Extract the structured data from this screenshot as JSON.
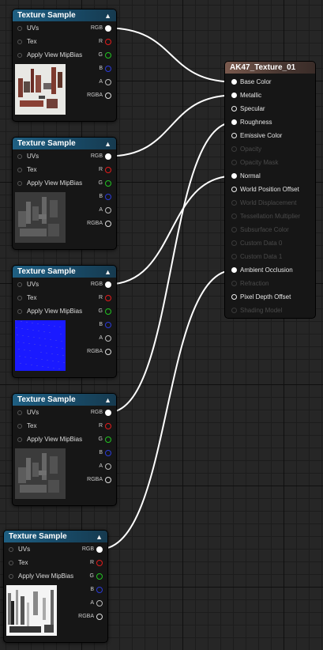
{
  "texture_nodes": [
    {
      "title": "Texture Sample",
      "inputs": [
        "UVs",
        "Tex",
        "Apply View MipBias"
      ],
      "outputs": [
        {
          "label": "RGB",
          "color": "#ffffff"
        },
        {
          "label": "R",
          "color": "#e21c1c"
        },
        {
          "label": "G",
          "color": "#22c422"
        },
        {
          "label": "B",
          "color": "#2a3bd8"
        },
        {
          "label": "A",
          "color": "#bbbbbb"
        },
        {
          "label": "RGBA",
          "color": "#dddddd"
        }
      ],
      "preview": "metal-parts-color"
    },
    {
      "title": "Texture Sample",
      "inputs": [
        "UVs",
        "Tex",
        "Apply View MipBias"
      ],
      "outputs": [
        {
          "label": "RGB",
          "color": "#ffffff"
        },
        {
          "label": "R",
          "color": "#e21c1c"
        },
        {
          "label": "G",
          "color": "#22c422"
        },
        {
          "label": "B",
          "color": "#2a3bd8"
        },
        {
          "label": "A",
          "color": "#bbbbbb"
        },
        {
          "label": "RGBA",
          "color": "#dddddd"
        }
      ],
      "preview": "metallic-gray"
    },
    {
      "title": "Texture Sample",
      "inputs": [
        "UVs",
        "Tex",
        "Apply View MipBias"
      ],
      "outputs": [
        {
          "label": "RGB",
          "color": "#ffffff"
        },
        {
          "label": "R",
          "color": "#e21c1c"
        },
        {
          "label": "G",
          "color": "#22c422"
        },
        {
          "label": "B",
          "color": "#2a3bd8"
        },
        {
          "label": "A",
          "color": "#bbbbbb"
        },
        {
          "label": "RGBA",
          "color": "#dddddd"
        }
      ],
      "preview": "normal-blue"
    },
    {
      "title": "Texture Sample",
      "inputs": [
        "UVs",
        "Tex",
        "Apply View MipBias"
      ],
      "outputs": [
        {
          "label": "RGB",
          "color": "#ffffff"
        },
        {
          "label": "R",
          "color": "#e21c1c"
        },
        {
          "label": "G",
          "color": "#22c422"
        },
        {
          "label": "B",
          "color": "#2a3bd8"
        },
        {
          "label": "A",
          "color": "#bbbbbb"
        },
        {
          "label": "RGBA",
          "color": "#dddddd"
        }
      ],
      "preview": "roughness-gray"
    },
    {
      "title": "Texture Sample",
      "inputs": [
        "UVs",
        "Tex",
        "Apply View MipBias"
      ],
      "outputs": [
        {
          "label": "RGB",
          "color": "#ffffff"
        },
        {
          "label": "R",
          "color": "#e21c1c"
        },
        {
          "label": "G",
          "color": "#22c422"
        },
        {
          "label": "B",
          "color": "#2a3bd8"
        },
        {
          "label": "A",
          "color": "#bbbbbb"
        },
        {
          "label": "RGBA",
          "color": "#dddddd"
        }
      ],
      "preview": "ao-white"
    }
  ],
  "material_node": {
    "title": "AK47_Texture_01",
    "pins": [
      {
        "label": "Base Color",
        "active": true,
        "connected": true
      },
      {
        "label": "Metallic",
        "active": true,
        "connected": true
      },
      {
        "label": "Specular",
        "active": true,
        "connected": false
      },
      {
        "label": "Roughness",
        "active": true,
        "connected": true
      },
      {
        "label": "Emissive Color",
        "active": true,
        "connected": false
      },
      {
        "label": "Opacity",
        "active": false,
        "connected": false
      },
      {
        "label": "Opacity Mask",
        "active": false,
        "connected": false
      },
      {
        "label": "Normal",
        "active": true,
        "connected": true
      },
      {
        "label": "World Position Offset",
        "active": true,
        "connected": false
      },
      {
        "label": "World Displacement",
        "active": false,
        "connected": false
      },
      {
        "label": "Tessellation Multiplier",
        "active": false,
        "connected": false
      },
      {
        "label": "Subsurface Color",
        "active": false,
        "connected": false
      },
      {
        "label": "Custom Data 0",
        "active": false,
        "connected": false
      },
      {
        "label": "Custom Data 1",
        "active": false,
        "connected": false
      },
      {
        "label": "Ambient Occlusion",
        "active": true,
        "connected": true
      },
      {
        "label": "Refraction",
        "active": false,
        "connected": false
      },
      {
        "label": "Pixel Depth Offset",
        "active": true,
        "connected": false
      },
      {
        "label": "Shading Model",
        "active": false,
        "connected": false
      }
    ]
  },
  "connections": [
    {
      "from": 0,
      "to": "Base Color"
    },
    {
      "from": 1,
      "to": "Metallic"
    },
    {
      "from": 2,
      "to": "Normal"
    },
    {
      "from": 3,
      "to": "Roughness"
    },
    {
      "from": 4,
      "to": "Ambient Occlusion"
    }
  ],
  "icons": {
    "collapse": "triangle-up-icon",
    "pin": "circle-icon"
  }
}
